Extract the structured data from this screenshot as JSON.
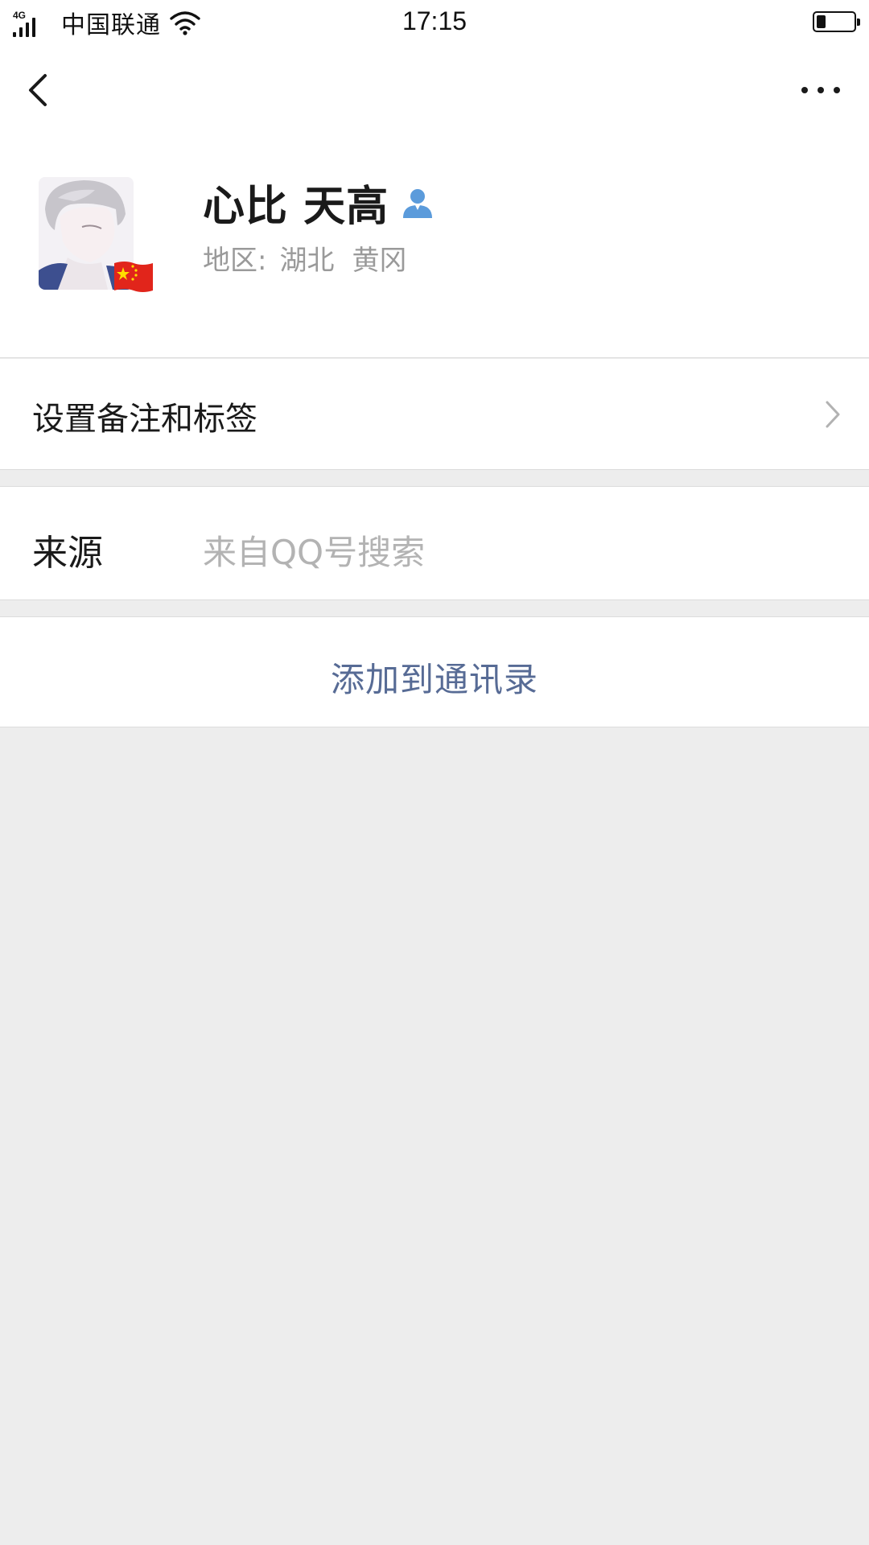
{
  "status_bar": {
    "network": "4G",
    "carrier": "中国联通",
    "time": "17:15",
    "battery_level_percent": 25
  },
  "nav": {
    "back_icon": "chevron-left-icon",
    "more_icon": "more-horizontal-icon"
  },
  "profile": {
    "name": "心比 天高",
    "gender_icon": "male-user-icon",
    "region_label": "地区:",
    "region_province": "湖北",
    "region_city": "黄冈",
    "flag_badge": "china-flag-icon"
  },
  "cells": {
    "remark_label": "设置备注和标签",
    "source_label": "来源",
    "source_value": "来自QQ号搜索",
    "add_contact_label": "添加到通讯录"
  },
  "colors": {
    "background": "#ededed",
    "link_blue": "#576b95",
    "gender_blue": "#5b9bdb",
    "secondary_text": "#9a9a9a"
  }
}
